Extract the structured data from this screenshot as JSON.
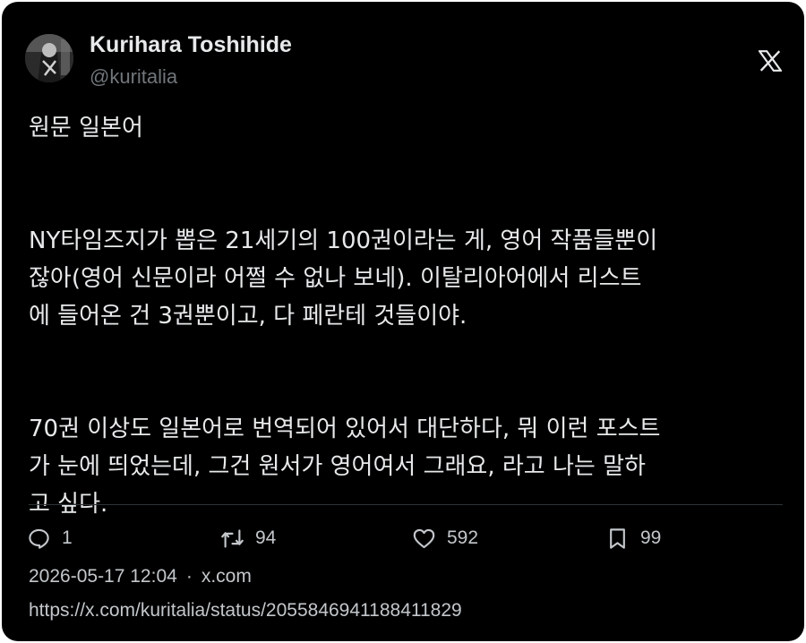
{
  "author": {
    "display_name": "Kurihara Toshihide",
    "handle": "@kuritalia",
    "avatar_icon": "profile-photo"
  },
  "platform_icon": "x-logo-icon",
  "post": {
    "paragraphs": [
      [
        "원문 일본어"
      ],
      [
        "NY타임즈지가 뽑은 21세기의 100권이라는 게, 영어 작품들뿐이",
        "잖아(영어 신문이라 어쩔 수 없나 보네). 이탈리아어에서 리스트",
        "에 들어온 건 3권뿐이고, 다 페란테 것들이야."
      ],
      [
        "70권 이상도 일본어로 번역되어 있어서 대단하다, 뭐 이런 포스트",
        "가 눈에 띄었는데, 그건 원서가 영어여서 그래요, 라고 나는 말하",
        "고 싶다."
      ]
    ]
  },
  "actions": {
    "reply": {
      "icon": "reply-icon",
      "count": "1"
    },
    "repost": {
      "icon": "repost-icon",
      "count": "94"
    },
    "like": {
      "icon": "heart-icon",
      "count": "592"
    },
    "bookmark": {
      "icon": "bookmark-icon",
      "count": "99"
    }
  },
  "meta": {
    "timestamp": "2026-05-17 12:04",
    "separator": "·",
    "source": "x.com"
  },
  "url": "https://x.com/kuritalia/status/2055846941188411829",
  "colors": {
    "background": "#000000",
    "text": "#e7e9ea",
    "secondary": "#71767b",
    "divider": "#2f3336"
  }
}
